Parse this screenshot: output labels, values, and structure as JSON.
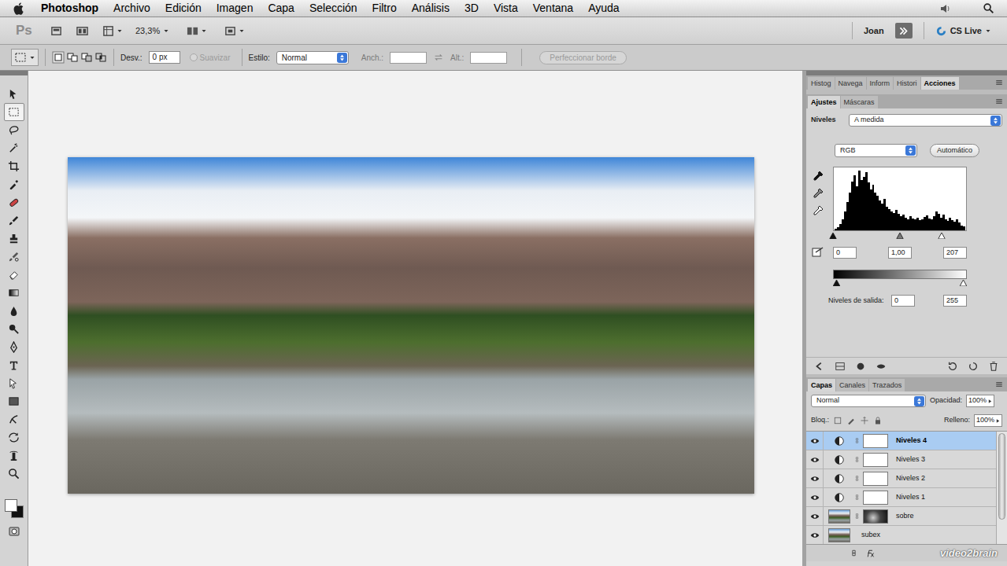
{
  "menubar": {
    "app": "Photoshop",
    "items": [
      "Archivo",
      "Edición",
      "Imagen",
      "Capa",
      "Selección",
      "Filtro",
      "Análisis",
      "3D",
      "Vista",
      "Ventana",
      "Ayuda"
    ]
  },
  "appbar": {
    "logo": "Ps",
    "zoom": "23,3%",
    "user": "Joan",
    "cs_live": "CS Live"
  },
  "options": {
    "feather_label": "Desv.:",
    "feather": "0 px",
    "antialias": {
      "label": "Suavizar",
      "checked": false,
      "disabled": true
    },
    "style_label": "Estilo:",
    "style": "Normal",
    "width_label": "Anch.:",
    "height_label": "Alt.:",
    "refine": {
      "label": "Perfeccionar borde",
      "disabled": true
    }
  },
  "tools": [
    {
      "selected": false
    },
    {
      "selected": true
    },
    {
      "selected": false
    },
    {
      "selected": false
    },
    {
      "selected": false
    },
    {
      "selected": false
    },
    {
      "selected": false
    },
    {
      "selected": false
    },
    {
      "selected": false
    },
    {
      "selected": false
    },
    {
      "selected": false
    },
    {
      "selected": false
    },
    {
      "selected": false
    },
    {
      "selected": false
    },
    {
      "selected": false
    },
    {
      "selected": false
    },
    {
      "selected": false
    },
    {
      "selected": false
    },
    {
      "selected": false
    },
    {
      "selected": false
    },
    {
      "selected": false
    },
    {
      "selected": false
    }
  ],
  "swatches": {
    "foreground": "#ffffff",
    "background": "#111111"
  },
  "panel_tabs": [
    {
      "label": "Histog",
      "selected": false
    },
    {
      "label": "Navega",
      "selected": false
    },
    {
      "label": "Inform",
      "selected": false
    },
    {
      "label": "Histori",
      "selected": false
    },
    {
      "label": "Acciones",
      "selected": true
    }
  ],
  "adjustments": {
    "tabs": [
      {
        "label": "Ajustes",
        "selected": true
      },
      {
        "label": "Máscaras",
        "selected": false
      }
    ],
    "preset_label": "Niveles",
    "preset": "A medida",
    "channel": "RGB",
    "auto_button": "Automático",
    "histogram": {
      "values": [
        2,
        5,
        10,
        18,
        30,
        45,
        60,
        78,
        88,
        70,
        95,
        80,
        85,
        92,
        76,
        65,
        72,
        60,
        55,
        48,
        42,
        50,
        38,
        34,
        30,
        28,
        32,
        26,
        22,
        25,
        20,
        18,
        22,
        19,
        17,
        20,
        16,
        18,
        21,
        24,
        19,
        17,
        22,
        30,
        26,
        20,
        25,
        18,
        15,
        20,
        16,
        14,
        17,
        12,
        8,
        6
      ]
    },
    "input_sliders": [
      {
        "level": 0
      },
      {
        "level": 0.5
      },
      {
        "level": 0.812
      }
    ],
    "input": [
      "0",
      "1,00",
      "207"
    ],
    "output_sliders": [
      {
        "level": 0
      },
      {
        "level": 1
      }
    ],
    "output_label": "Niveles de salida:",
    "output": [
      "0",
      "255"
    ]
  },
  "layers": {
    "tabs": [
      {
        "label": "Capas",
        "selected": true
      },
      {
        "label": "Canales",
        "selected": false
      },
      {
        "label": "Trazados",
        "selected": false
      }
    ],
    "blend": "Normal",
    "opacity_label": "Opacidad:",
    "opacity": "100%",
    "lock_label": "Bloq.:",
    "fill_label": "Relleno:",
    "fill": "100%",
    "items": [
      {
        "name": "Niveles 4",
        "selected": true,
        "visible": true,
        "kind": "adjustment",
        "mask": "light"
      },
      {
        "name": "Niveles 3",
        "selected": false,
        "visible": true,
        "kind": "adjustment",
        "mask": "light"
      },
      {
        "name": "Niveles 2",
        "selected": false,
        "visible": true,
        "kind": "adjustment",
        "mask": "light"
      },
      {
        "name": "Niveles 1",
        "selected": false,
        "visible": true,
        "kind": "adjustment",
        "mask": "light"
      },
      {
        "name": "sobre",
        "selected": false,
        "visible": true,
        "kind": "pixel",
        "mask": "dark"
      },
      {
        "name": "subex",
        "selected": false,
        "visible": true,
        "kind": "pixel",
        "mask": "none"
      }
    ]
  },
  "watermark": "video2brain"
}
